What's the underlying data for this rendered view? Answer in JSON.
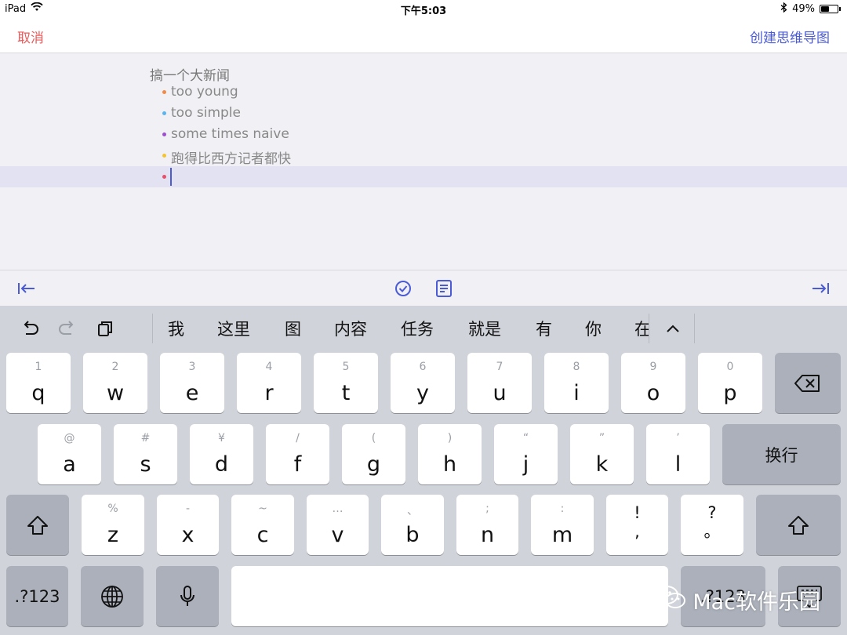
{
  "status_bar": {
    "device": "iPad",
    "time": "下午5:03",
    "battery_text": "49%",
    "battery_level": 0.49,
    "icons": [
      "wifi-icon",
      "bluetooth-icon",
      "battery-icon"
    ]
  },
  "nav": {
    "cancel": "取消",
    "create": "创建思维导图",
    "cancel_color": "#ea5a5a",
    "accent_color": "#4b5bd6"
  },
  "outline": {
    "root": "搞一个大新闻",
    "items": [
      {
        "text": "too young",
        "bullet_color": "#f08a4b"
      },
      {
        "text": "too simple",
        "bullet_color": "#5ab4ee"
      },
      {
        "text": "some times naive",
        "bullet_color": "#9d4fd0"
      },
      {
        "text": "跑得比西方记者都快",
        "bullet_color": "#f4c430"
      },
      {
        "text": "",
        "bullet_color": "#e84f6a",
        "active": true
      }
    ]
  },
  "accessory": {
    "icons": [
      "outdent-icon",
      "checkbox-icon",
      "note-icon",
      "indent-icon"
    ]
  },
  "keyboard": {
    "toolbar_icons": [
      "undo-icon",
      "redo-icon",
      "clipboard-icon",
      "collapse-icon"
    ],
    "candidates": [
      "我",
      "这里",
      "图",
      "内容",
      "任务",
      "就是",
      "有",
      "你",
      "在"
    ],
    "row1": [
      {
        "hint": "1",
        "key": "q"
      },
      {
        "hint": "2",
        "key": "w"
      },
      {
        "hint": "3",
        "key": "e"
      },
      {
        "hint": "4",
        "key": "r"
      },
      {
        "hint": "5",
        "key": "t"
      },
      {
        "hint": "6",
        "key": "y"
      },
      {
        "hint": "7",
        "key": "u"
      },
      {
        "hint": "8",
        "key": "i"
      },
      {
        "hint": "9",
        "key": "o"
      },
      {
        "hint": "0",
        "key": "p"
      }
    ],
    "row2": [
      {
        "hint": "@",
        "key": "a"
      },
      {
        "hint": "#",
        "key": "s"
      },
      {
        "hint": "¥",
        "key": "d"
      },
      {
        "hint": "/",
        "key": "f"
      },
      {
        "hint": "(",
        "key": "g"
      },
      {
        "hint": ")",
        "key": "h"
      },
      {
        "hint": "“",
        "key": "j"
      },
      {
        "hint": "”",
        "key": "k"
      },
      {
        "hint": "’",
        "key": "l"
      }
    ],
    "row3": [
      {
        "hint": "%",
        "key": "z"
      },
      {
        "hint": "-",
        "key": "x"
      },
      {
        "hint": "~",
        "key": "c"
      },
      {
        "hint": "…",
        "key": "v"
      },
      {
        "hint": "、",
        "key": "b"
      },
      {
        "hint": ";",
        "key": "n"
      },
      {
        "hint": ":",
        "key": "m"
      }
    ],
    "punct_keys": [
      {
        "top": "!",
        "bottom": ","
      },
      {
        "top": "?",
        "bottom": "。"
      }
    ],
    "return_label": "换行",
    "numbers_label": ".?123",
    "right_numbers_label": ".?123"
  },
  "watermark": {
    "text": "Mac软件乐园"
  }
}
